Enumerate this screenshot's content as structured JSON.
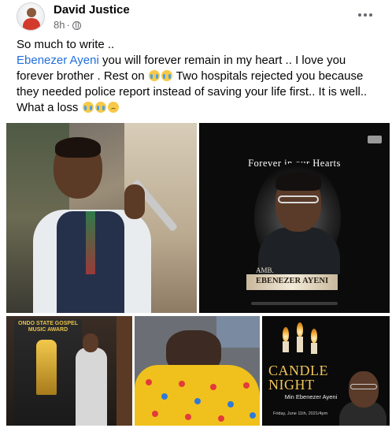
{
  "post": {
    "author": "David Justice",
    "time": "8h",
    "dot": "·",
    "visibility_icon": "globe-icon",
    "more_icon": "more-options-icon"
  },
  "text": {
    "line1": "So much to write ..",
    "mention": "Ebenezer Ayeni",
    "part2": " you will forever remain in my heart .. I love you forever brother . Rest on ",
    "part3": " Two hospitals rejected you because they needed police report instead of saving your life first.. It is well.. What a loss ",
    "emoji_1": "loudly-crying-face-emoji",
    "emoji_2": "sad-face-emoji"
  },
  "photos": {
    "memorial_title": "Forever in our Hearts",
    "memorial_prefix": "AMB.",
    "memorial_name": "EBENEZER AYENI",
    "award_title": "ONDO STATE GOSPEL MUSIC AWARD",
    "candle_title": "CANDLE NIGHT",
    "candle_name": "Min Ebenezer Ayeni",
    "candle_date": "Friday, June 11th, 2021/4pm"
  },
  "colors": {
    "link": "#216fdb",
    "meta": "#65676b",
    "text": "#050505",
    "gold": "#f2c65a"
  }
}
